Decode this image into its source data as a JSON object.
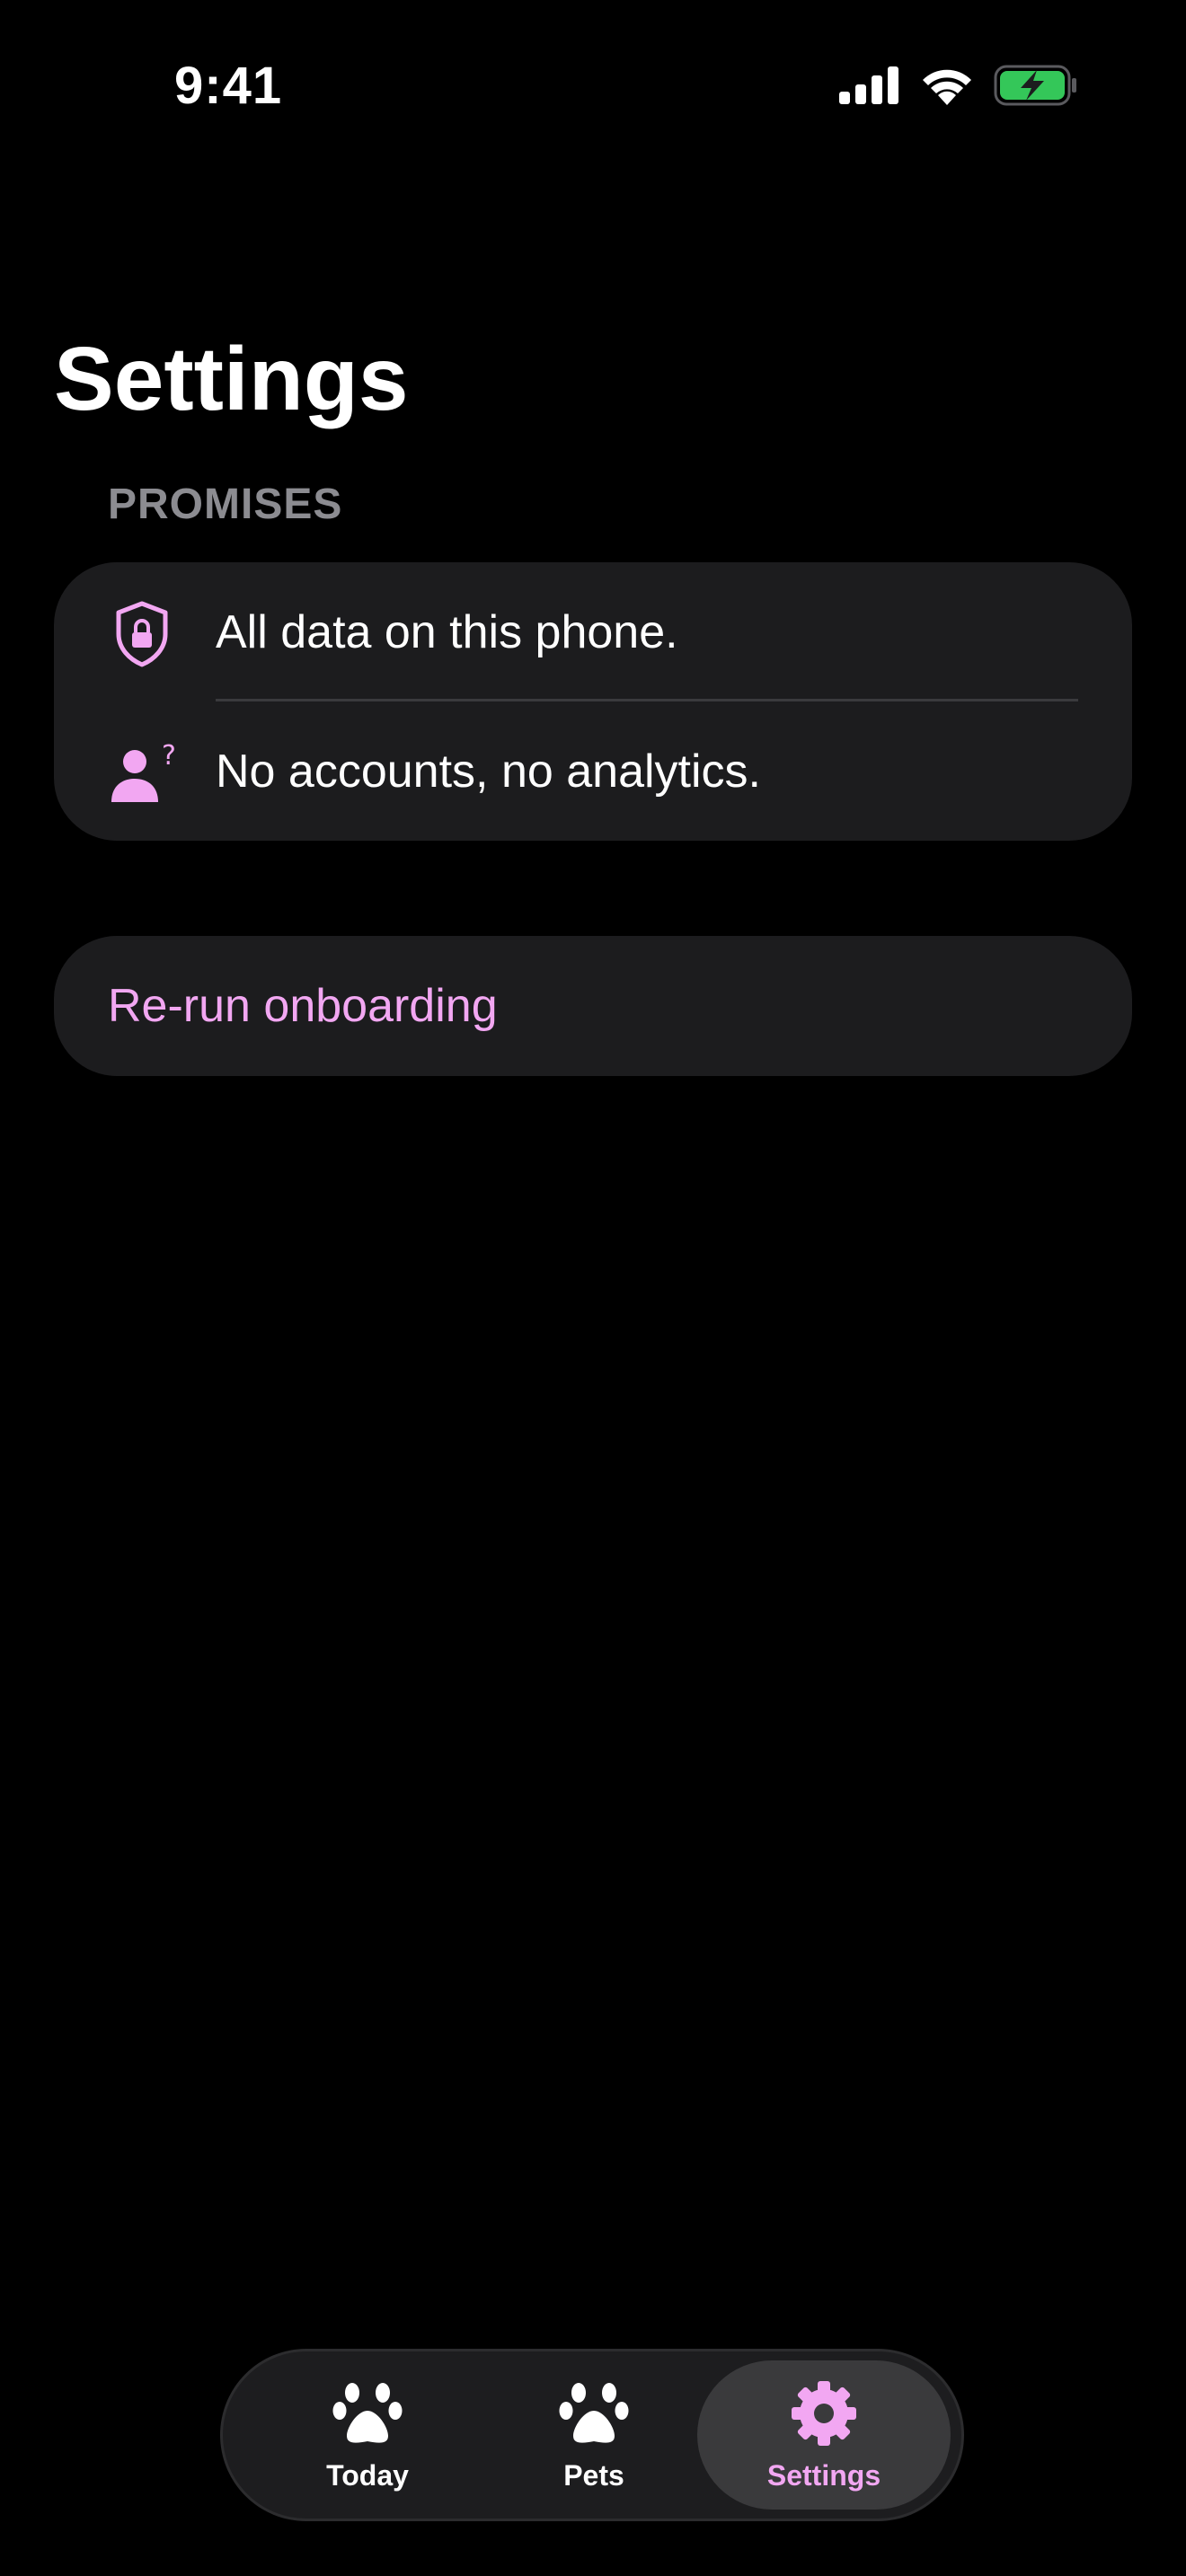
{
  "status_bar": {
    "time": "9:41",
    "icons": [
      "cellular-signal-icon",
      "wifi-icon",
      "battery-charging-icon"
    ],
    "battery_color": "#34c759"
  },
  "page": {
    "title": "Settings"
  },
  "promises": {
    "header": "PROMISES",
    "items": [
      {
        "icon": "shield-lock-icon",
        "label": "All data on this phone."
      },
      {
        "icon": "person-question-icon",
        "label": "No accounts, no analytics."
      }
    ]
  },
  "actions": {
    "rerun_onboarding": "Re-run onboarding"
  },
  "tab_bar": {
    "selected": "Settings",
    "tabs": [
      {
        "icon": "paw-icon",
        "label": "Today"
      },
      {
        "icon": "paw-icon",
        "label": "Pets"
      },
      {
        "icon": "gear-icon",
        "label": "Settings"
      }
    ]
  },
  "colors": {
    "accent": "#f2a7f2",
    "background": "#000000",
    "card": "#1c1c1e",
    "secondary_text": "#8c8c91"
  }
}
